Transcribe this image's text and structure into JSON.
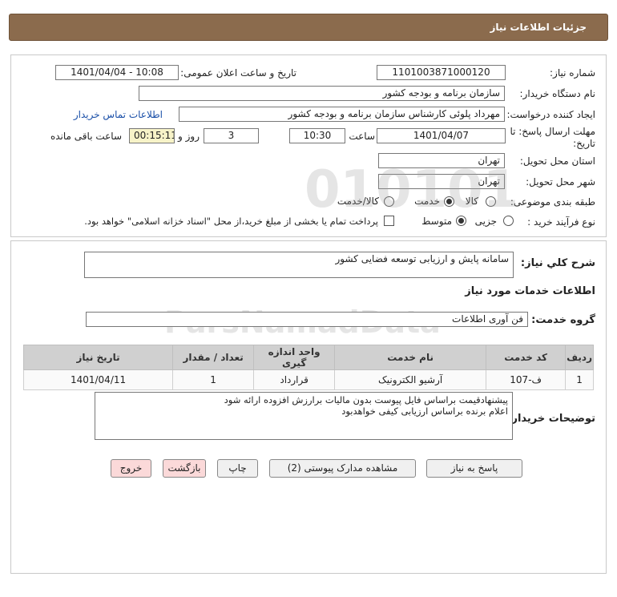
{
  "header": {
    "title": "جزئیات اطلاعات نیاز"
  },
  "fields": {
    "need_number_label": "شماره نیاز:",
    "need_number": "1101003871000120",
    "announce_label": "تاریخ و ساعت اعلان عمومی:",
    "announce_value": "1401/04/04 - 10:08",
    "buyer_org_label": "نام دستگاه خریدار:",
    "buyer_org": "سازمان برنامه و بودجه کشور",
    "requester_label": "ایجاد کننده درخواست:",
    "requester": "مهرداد پلوئی کارشناس سازمان برنامه و بودجه کشور",
    "contact_link": "اطلاعات تماس خریدار",
    "deadline_label_1": "مهلت ارسال پاسخ: تا",
    "deadline_label_2": "تاریخ:",
    "deadline_date": "1401/04/07",
    "time_label": "ساعت",
    "deadline_time": "10:30",
    "days_value": "3",
    "days_label": "روز و",
    "remaining_time": "00:15:11",
    "remaining_label": "ساعت باقی مانده",
    "province_label": "استان محل تحویل:",
    "province": "تهران",
    "city_label": "شهر محل تحویل:",
    "city": "تهران",
    "category_label": "طبقه بندی موضوعی:",
    "category_options": [
      "کالا",
      "خدمت",
      "کالا/خدمت"
    ],
    "category_selected": "خدمت",
    "process_label": "نوع فرآیند خرید :",
    "process_options": [
      "جزیی",
      "متوسط"
    ],
    "process_selected": "متوسط",
    "payment_note": "پرداخت تمام یا بخشی از مبلغ خرید،از محل \"اسناد خزانه اسلامی\" خواهد بود."
  },
  "general": {
    "desc_label": "شرح کلي نياز:",
    "desc_value": "سامانه پایش و ارزیابی توسعه فضایی کشور",
    "services_heading": "اطلاعات خدمات مورد نیاز",
    "group_label": "گروه خدمت:",
    "group_value": "فن آوری اطلاعات"
  },
  "table": {
    "headers": [
      "ردیف",
      "کد خدمت",
      "نام خدمت",
      "واحد اندازه گیری",
      "تعداد / مقدار",
      "تاریخ نیاز"
    ],
    "rows": [
      [
        "1",
        "ف-107",
        "آرشیو الکترونیک",
        "قرارداد",
        "1",
        "1401/04/11"
      ]
    ]
  },
  "buyer_notes": {
    "label": "توضیحات خریدار:",
    "line1": "پیشنهادقیمت براساس فایل پیوست بدون مالیات برارزش افزوده ارائه شود",
    "line2": "اعلام برنده براساس ارزیابی کیفی خواهدبود"
  },
  "buttons": {
    "reply": "پاسخ به نیاز",
    "attachments": "مشاهده مدارک پیوستی (2)",
    "print": "چاپ",
    "back": "بازگشت",
    "exit": "خروج"
  }
}
